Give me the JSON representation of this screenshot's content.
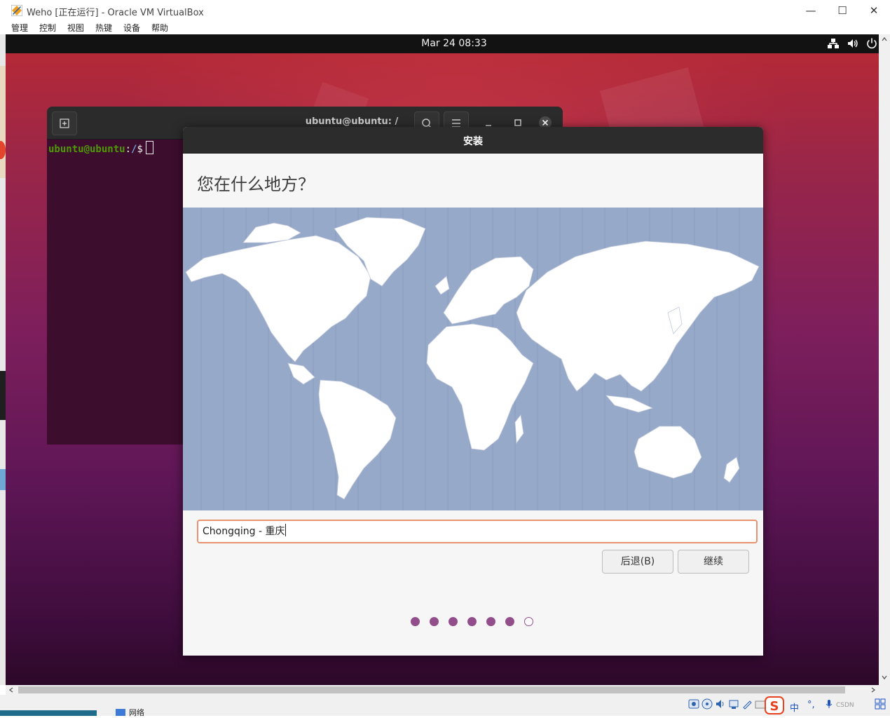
{
  "vbox": {
    "window_title": "Weho [正在运行] - Oracle VM VirtualBox",
    "menu": [
      "管理",
      "控制",
      "视图",
      "热键",
      "设备",
      "帮助"
    ],
    "controls": {
      "minimize": "—",
      "maximize": "☐",
      "close": "✕"
    }
  },
  "ubuntu": {
    "topbar": {
      "clock": "Mar 24  08:33"
    }
  },
  "terminal": {
    "title": "ubuntu@ubuntu: /",
    "prompt": {
      "user": "ubuntu@ubuntu",
      "sep": ":",
      "path": "/",
      "dollar": "$"
    }
  },
  "installer": {
    "title": "安装",
    "question": "您在什么地方？",
    "timezone_value": "Chongqing - 重庆",
    "back_button": "后退(B)",
    "continue_button": "继续",
    "progress": {
      "total": 7,
      "current": 7
    }
  },
  "statusbar": {
    "taskbar_label": "网络",
    "ime": {
      "lang": "中",
      "punct": "°,",
      "badge": "CSDN"
    }
  },
  "colors": {
    "accent_orange": "#e8936f",
    "progress_purple": "#924d8b",
    "map_ocean": "#97a9c9",
    "wallpaper_red": "#b82a34",
    "wallpaper_purple": "#5e1656"
  }
}
